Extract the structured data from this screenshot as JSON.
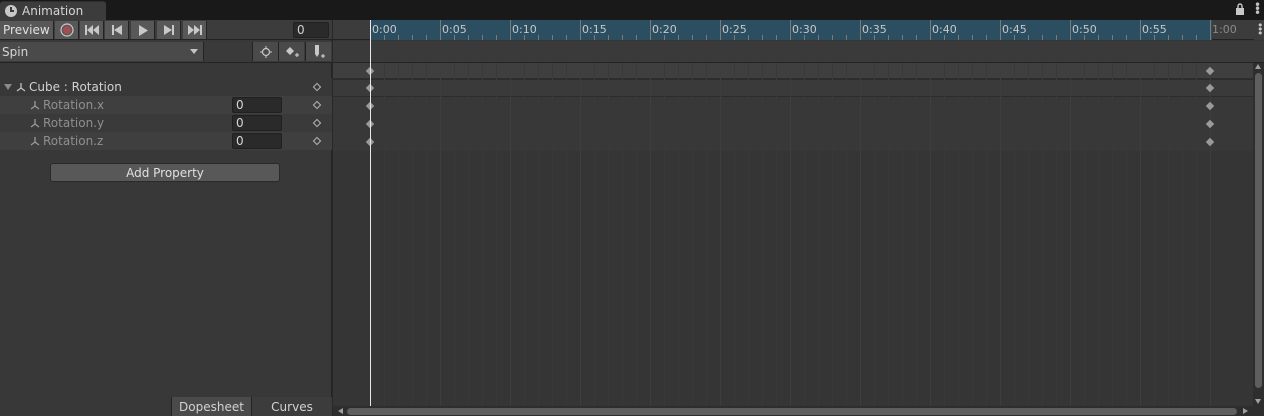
{
  "window": {
    "tab_title": "Animation",
    "tab_icon": "clock-icon"
  },
  "toolbar": {
    "preview_label": "Preview",
    "frame_value": "0",
    "buttons": [
      "record-icon",
      "first-key-icon",
      "prev-key-icon",
      "play-icon",
      "next-key-icon",
      "last-key-icon"
    ]
  },
  "clip": {
    "selected": "Spin",
    "tools": [
      "filter-by-selection-icon",
      "add-keyframe-icon",
      "add-event-icon"
    ]
  },
  "properties": {
    "group_label": "Cube : Rotation",
    "items": [
      {
        "label": "Rotation.x",
        "value": "0"
      },
      {
        "label": "Rotation.y",
        "value": "0"
      },
      {
        "label": "Rotation.z",
        "value": "0"
      }
    ],
    "add_button": "Add Property"
  },
  "bottom_tabs": {
    "dopesheet": "Dopesheet",
    "curves": "Curves"
  },
  "timeline": {
    "labels": [
      "0:00",
      "0:05",
      "0:10",
      "0:15",
      "0:20",
      "0:25",
      "0:30",
      "0:35",
      "0:40",
      "0:45",
      "0:50",
      "0:55",
      "1:00"
    ],
    "clip_end_label": "1:00",
    "playhead_time": "0:00",
    "keyframe_times": [
      "0:00",
      "1:00"
    ]
  },
  "colors": {
    "active_range": "#2c4e61",
    "panel": "#383838",
    "playhead": "#e8e8e8"
  }
}
